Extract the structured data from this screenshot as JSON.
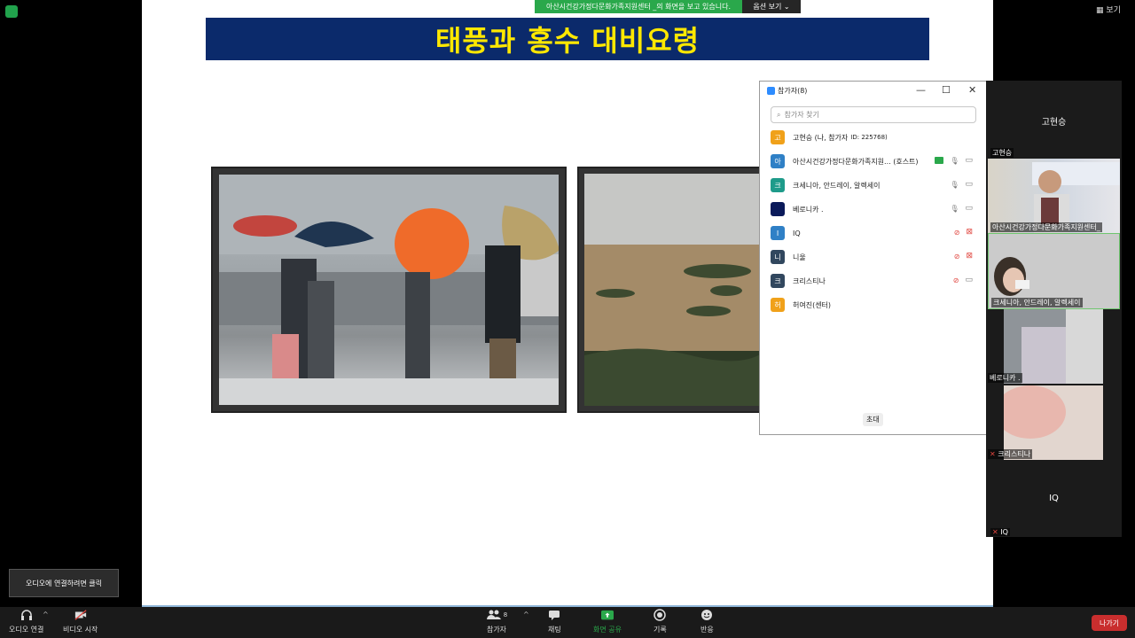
{
  "share_bar": {
    "message": "아산시건강가정다문화가족지원센터 _의 화면을 보고 있습니다.",
    "options_label": "옵션 보기 ⌄"
  },
  "view_button": {
    "label": "보기"
  },
  "slide": {
    "title": "태풍과 홍수 대비요령"
  },
  "participants_panel": {
    "title": "참가자(8)",
    "search_placeholder": "참가자 찾기",
    "participants": [
      {
        "initial": "고",
        "name": "고현승 (나, 참가자",
        "suffix": "ID: 225768)",
        "color": "#f0a11a",
        "mic": "none",
        "video": "none"
      },
      {
        "initial": "아",
        "name": "아산시건강가정다문화가족지원... (호스트)",
        "suffix": "",
        "color": "#2f80c6",
        "mic": "on",
        "video": "on",
        "sharing": true
      },
      {
        "initial": "크",
        "name": "크세니아, 안드레이, 알렉세이",
        "suffix": "",
        "color": "#1e9b8a",
        "mic": "on",
        "video": "on"
      },
      {
        "initial": "",
        "name": "베로니카 .",
        "suffix": "",
        "color": "#0a1a5a",
        "mic": "on",
        "video": "on"
      },
      {
        "initial": "I",
        "name": "IQ",
        "suffix": "",
        "color": "#2f80c6",
        "mic": "off",
        "video": "off"
      },
      {
        "initial": "니",
        "name": "니울",
        "suffix": "",
        "color": "#31475e",
        "mic": "off",
        "video": "off"
      },
      {
        "initial": "크",
        "name": "크리스티나",
        "suffix": "",
        "color": "#31475e",
        "mic": "off",
        "video": "on"
      },
      {
        "initial": "허",
        "name": "허여진(센터)",
        "suffix": "",
        "color": "#f0a11a",
        "mic": "none",
        "video": "none"
      }
    ],
    "invite_label": "초대"
  },
  "video_strip": {
    "tiles": [
      {
        "name": "고현승",
        "label": "고현승"
      },
      {
        "name": "아산시건강가정다문화가족지원센터",
        "label": "아산시건강가정다문화가족지원센터_"
      },
      {
        "name": "크세니아, 안드레이, 알렉세이",
        "label": "크세니아, 안드레이, 알렉세이"
      },
      {
        "name": "베로니카",
        "label": "베로니카 ."
      },
      {
        "name": "크리스티나",
        "label": "크리스티나"
      },
      {
        "name": "IQ",
        "label": "IQ"
      }
    ]
  },
  "tooltip": {
    "text": "오디오에 연결하려면 클릭"
  },
  "toolbar": {
    "audio_label": "오디오 연결",
    "video_label": "비디오 시작",
    "participants_label": "참가자",
    "participants_count": "8",
    "chat_label": "채팅",
    "share_label": "화면 공유",
    "record_label": "기록",
    "reactions_label": "반응",
    "leave_label": "나가기",
    "share_color": "#2aa84b",
    "leave_color": "#c92e2e"
  }
}
